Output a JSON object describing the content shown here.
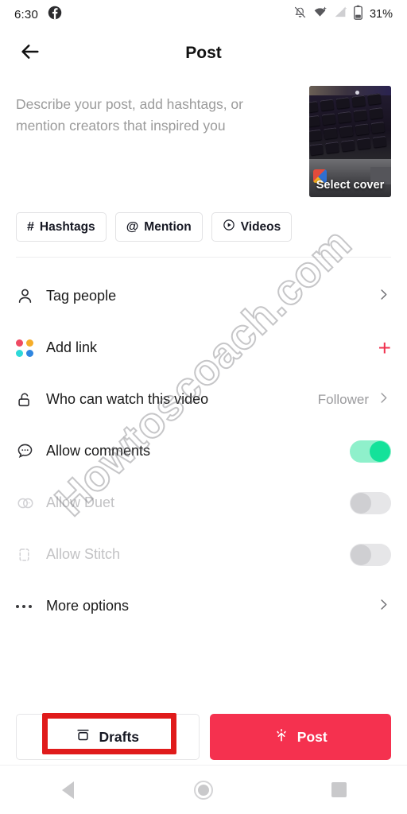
{
  "statusbar": {
    "time": "6:30",
    "app_icon": "facebook-icon",
    "icons": [
      "notifications-off-icon",
      "wifi-icon",
      "cellular-signal-icon",
      "battery-icon"
    ],
    "battery_percent": "31%"
  },
  "header": {
    "back_icon": "arrow-left-icon",
    "title": "Post"
  },
  "caption": {
    "placeholder": "Describe your post, add hashtags, or mention creators that inspired you",
    "value": ""
  },
  "cover": {
    "label": "Select cover"
  },
  "chips": [
    {
      "glyph": "#",
      "label": "Hashtags",
      "icon": "hashtag-icon"
    },
    {
      "glyph": "@",
      "label": "Mention",
      "icon": "at-mention-icon"
    },
    {
      "glyph": "▶",
      "label": "Videos",
      "icon": "play-circle-icon"
    }
  ],
  "settings": [
    {
      "label": "Tag people",
      "icon": "person-icon",
      "control": "chevron",
      "value": "",
      "disabled": false
    },
    {
      "label": "Add link",
      "icon": "four-dots-icon",
      "control": "plus",
      "value": "",
      "disabled": false
    },
    {
      "label": "Who can watch this video",
      "icon": "unlock-icon",
      "control": "value-chevron",
      "value": "Follower",
      "disabled": false
    },
    {
      "label": "Allow comments",
      "icon": "comment-bubble-icon",
      "control": "toggle",
      "value": "on",
      "disabled": false
    },
    {
      "label": "Allow Duet",
      "icon": "duet-icon",
      "control": "toggle",
      "value": "off",
      "disabled": true
    },
    {
      "label": "Allow Stitch",
      "icon": "stitch-icon",
      "control": "toggle",
      "value": "off",
      "disabled": true
    },
    {
      "label": "More options",
      "icon": "ellipsis-icon",
      "control": "chevron",
      "value": "",
      "disabled": false
    }
  ],
  "actions": {
    "drafts_label": "Drafts",
    "drafts_icon": "drafts-box-icon",
    "post_label": "Post",
    "post_icon": "upload-sparkle-icon"
  },
  "navbar": {
    "back": "nav-back-icon",
    "home": "nav-home-icon",
    "recents": "nav-recents-icon"
  },
  "watermark": {
    "text": "Howtoscoach.com"
  },
  "colors": {
    "accent_red": "#f5314f",
    "toggle_on": "#14e29a",
    "toggle_track_on": "#8ff0cb",
    "toggle_off": "#cfcfd2",
    "highlight_box": "#e01b1b",
    "link_dot_1": "#ef4a63",
    "link_dot_2": "#f6ad28",
    "link_dot_3": "#2ed9d9",
    "link_dot_4": "#2f86e0"
  }
}
